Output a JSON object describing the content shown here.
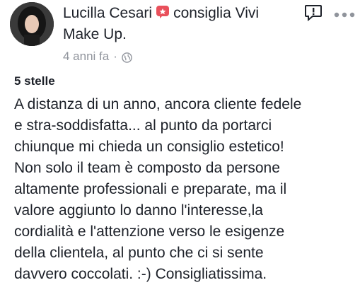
{
  "post": {
    "author_name": "Lucilla Cesari",
    "action_text": "consiglia Vivi",
    "page_name": "Make Up.",
    "timestamp": "4 anni fa",
    "separator": "·",
    "privacy_icon": "globe-icon",
    "recommend_icon": "recommend-badge-icon",
    "accent_color": "#e9505b",
    "rating_label": "5 stelle",
    "body_lines": [
      "A distanza di un anno, ancora cliente fedele",
      "e stra-soddisfatta... al punto da portarci",
      "chiunque mi chieda un consiglio estetico!",
      "Non solo il team è composto da persone",
      "altamente professionali e preparate, ma il",
      "valore aggiunto lo danno l'interesse,la",
      "cordialità e l'attenzione verso le esigenze",
      "della clientela, al punto che ci si sente",
      "davvero coccolati. :-) Consigliatissima."
    ]
  },
  "actions": {
    "report_icon": "report-icon",
    "more_icon": "more-options-icon"
  }
}
